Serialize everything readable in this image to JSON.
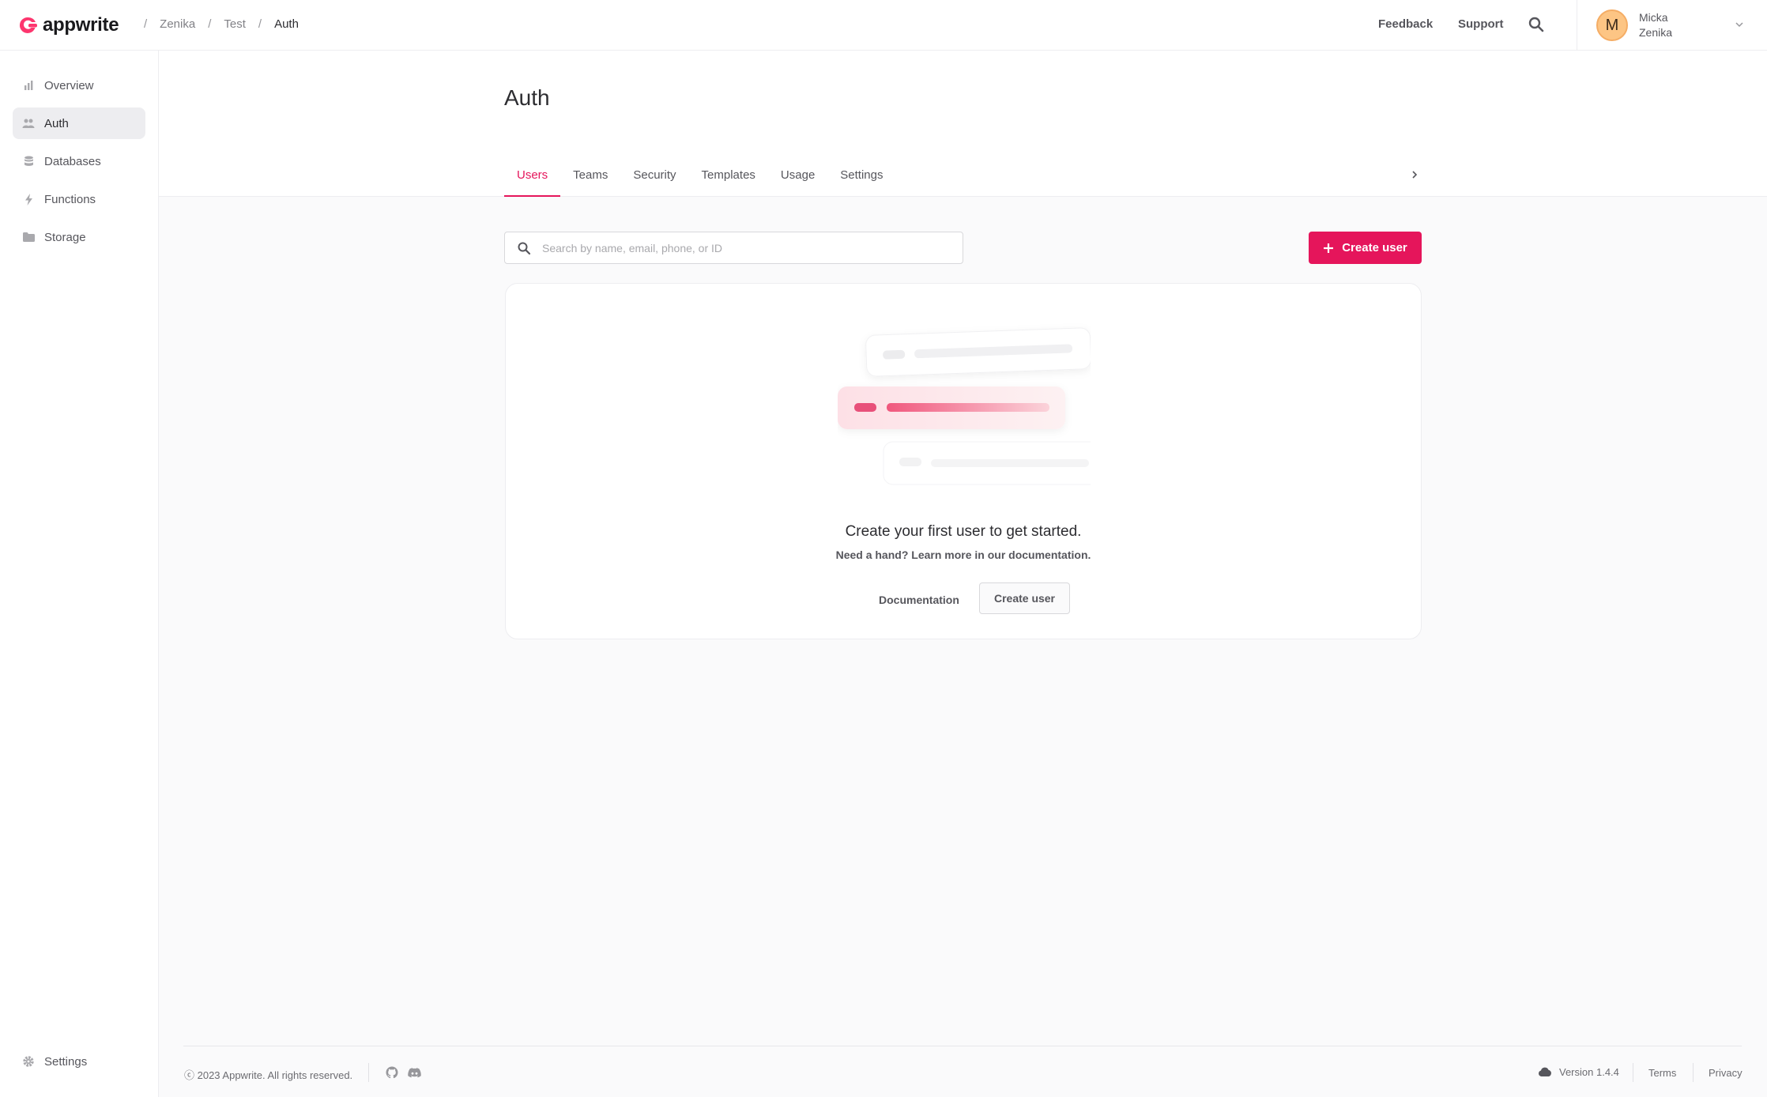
{
  "app": {
    "logo_text": "appwrite",
    "brand_color": "#e5155b"
  },
  "breadcrumb": {
    "separator": "/",
    "items": [
      "Zenika",
      "Test",
      "Auth"
    ]
  },
  "header": {
    "feedback_label": "Feedback",
    "support_label": "Support",
    "search_icon": "search-icon",
    "user": {
      "initial": "M",
      "first_name": "Micka",
      "org": "Zenika",
      "avatar_color": "#fdc584"
    }
  },
  "sidebar": {
    "items": [
      {
        "label": "Overview",
        "icon": "chart-icon"
      },
      {
        "label": "Auth",
        "icon": "users-icon",
        "active": true
      },
      {
        "label": "Databases",
        "icon": "database-icon"
      },
      {
        "label": "Functions",
        "icon": "lightning-icon"
      },
      {
        "label": "Storage",
        "icon": "folder-icon"
      }
    ],
    "settings_label": "Settings"
  },
  "page": {
    "title": "Auth",
    "tabs": [
      {
        "label": "Users",
        "active": true
      },
      {
        "label": "Teams"
      },
      {
        "label": "Security"
      },
      {
        "label": "Templates"
      },
      {
        "label": "Usage"
      },
      {
        "label": "Settings"
      }
    ]
  },
  "search": {
    "placeholder": "Search by name, email, phone, or ID",
    "value": ""
  },
  "toolbar": {
    "create_user_label": "Create user"
  },
  "empty_state": {
    "title": "Create your first user to get started.",
    "subtitle": "Need a hand? Learn more in our documentation.",
    "documentation_label": "Documentation",
    "create_user_label": "Create user"
  },
  "footer": {
    "copyright": "ⓒ 2023 Appwrite. All rights reserved.",
    "version": "Version 1.4.4",
    "terms_label": "Terms",
    "privacy_label": "Privacy"
  }
}
